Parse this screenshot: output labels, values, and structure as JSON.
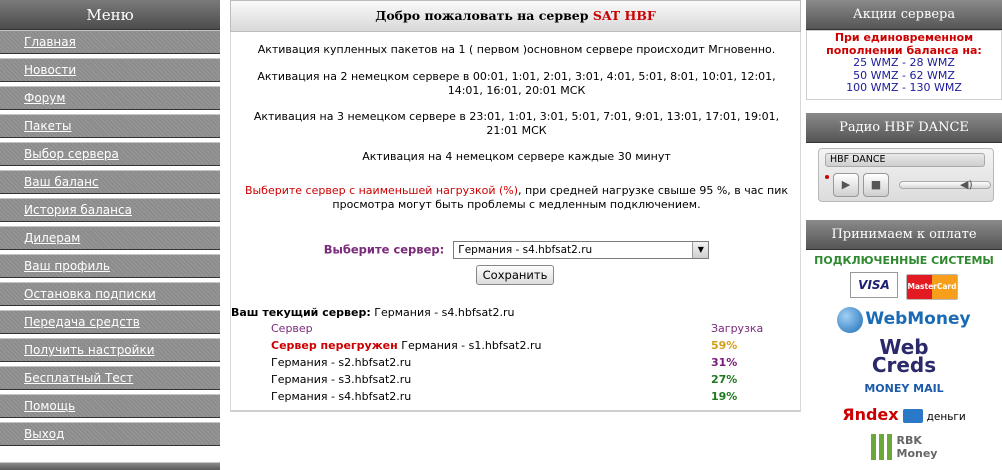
{
  "menu": {
    "title": "Меню",
    "items": [
      "Главная",
      "Новости",
      "Форум",
      "Пакеты",
      "Выбор сервера",
      "Ваш баланс",
      "История баланса",
      "Дилерам",
      "Ваш профиль",
      "Остановка подписки",
      "Передача средств",
      "Получить настройки",
      "Бесплатный Тест",
      "Помощь",
      "Выход"
    ]
  },
  "center": {
    "welcome": "Добро пожаловать на сервер",
    "brand": "SAT HBF",
    "p1": "Активация купленных пакетов на 1 ( первом )основном сервере происходит Мгновенно.",
    "p2a": "Активация на 2 немецком сервере в 00:01, 1:01, 2:01, 3:01, 4:01, 5:01, 8:01, 10:01, 12:01,",
    "p2b": "14:01, 16:01, 20:01 МСК",
    "p3a": "Активация на 3 немецком сервере в 23:01, 1:01, 3:01, 5:01, 7:01, 9:01, 13:01, 17:01, 19:01,",
    "p3b": "21:01 МСК",
    "p4": "Активация на 4 немецком сервере каждые 30 минут",
    "warn_red": "Выберите сервер с наименьшей нагрузкой (%)",
    "warn_rest_a": ", при средней нагрузке свыше 95 %, в час пик",
    "warn_rest_b": "просмотра могут быть проблемы с медленным подключением.",
    "select_label": "Выберите сервер:",
    "select_value": "Германия - s4.hbfsat2.ru",
    "save_label": "Сохранить",
    "current_label": "Ваш текущий сервер:",
    "current_value": "Германия - s4.hbfsat2.ru",
    "table": {
      "col_server": "Сервер",
      "col_load": "Загрузка",
      "overloaded_label": "Сервер перегружен",
      "rows": [
        {
          "server": "Германия - s1.hbfsat2.ru",
          "load": "59%",
          "color": "#d4a017"
        },
        {
          "server": "Германия - s2.hbfsat2.ru",
          "load": "31%",
          "color": "#7a1a7a"
        },
        {
          "server": "Германия - s3.hbfsat2.ru",
          "load": "27%",
          "color": "#1f7a1f"
        },
        {
          "server": "Германия - s4.hbfsat2.ru",
          "load": "19%",
          "color": "#1f7a1f"
        }
      ]
    }
  },
  "right": {
    "promo_title": "Акции сервера",
    "promo_head_a": "При единовременном",
    "promo_head_b": "пополнении баланса на:",
    "promo_lines": [
      "25 WMZ - 28 WMZ",
      "50 WMZ - 62 WMZ",
      "100 WMZ - 130 WMZ"
    ],
    "radio_title": "Радио HBF DANCE",
    "player_name": "HBF DANCE",
    "pay_title": "Принимаем к оплате",
    "connected": "ПОДКЛЮЧЕННЫЕ СИСТЕМЫ",
    "logos": {
      "visa": "VISA",
      "mastercard": "MasterCard",
      "webmoney": "WebMoney",
      "webcreds_a": "Web",
      "webcreds_b": "Creds",
      "moneymail": "MONEY MAIL",
      "yandex_a": "Яndex",
      "yandex_b": "деньги",
      "rbk_a": "RBK",
      "rbk_b": "Money"
    }
  }
}
